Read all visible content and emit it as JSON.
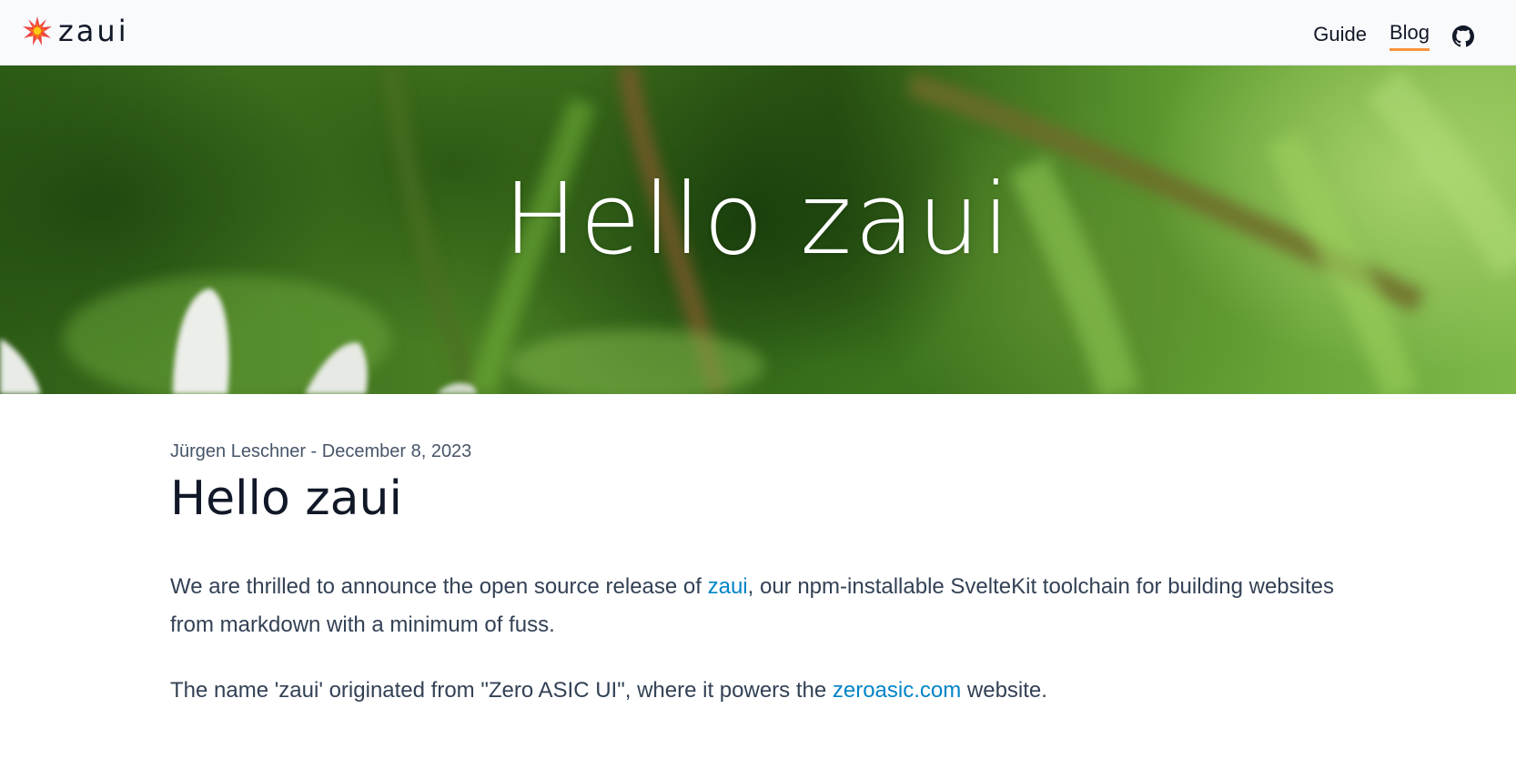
{
  "header": {
    "brand_name": "zaui",
    "logo_icon": "starburst-logo-icon",
    "nav": [
      {
        "label": "Guide",
        "active": false
      },
      {
        "label": "Blog",
        "active": true
      }
    ],
    "github_icon": "github-icon",
    "active_underline_color": "#fb923c"
  },
  "hero": {
    "title": "Hello zaui",
    "background": "blurred green foliage photo with white petals"
  },
  "article": {
    "author": "Jürgen Leschner",
    "separator": " - ",
    "date": "December 8, 2023",
    "title": "Hello zaui",
    "paragraph1": {
      "before": "We are thrilled to announce the open source release of ",
      "link_text": "zaui",
      "after": ", our npm-installable SvelteKit toolchain for building websites from markdown with a minimum of fuss."
    },
    "paragraph2": {
      "before": "The name 'zaui' originated from \"Zero ASIC UI\", where it powers the ",
      "link_text": "zeroasic.com",
      "after": " website."
    }
  },
  "colors": {
    "link": "#0284c7",
    "heading": "#111827",
    "body_text": "#334155"
  }
}
